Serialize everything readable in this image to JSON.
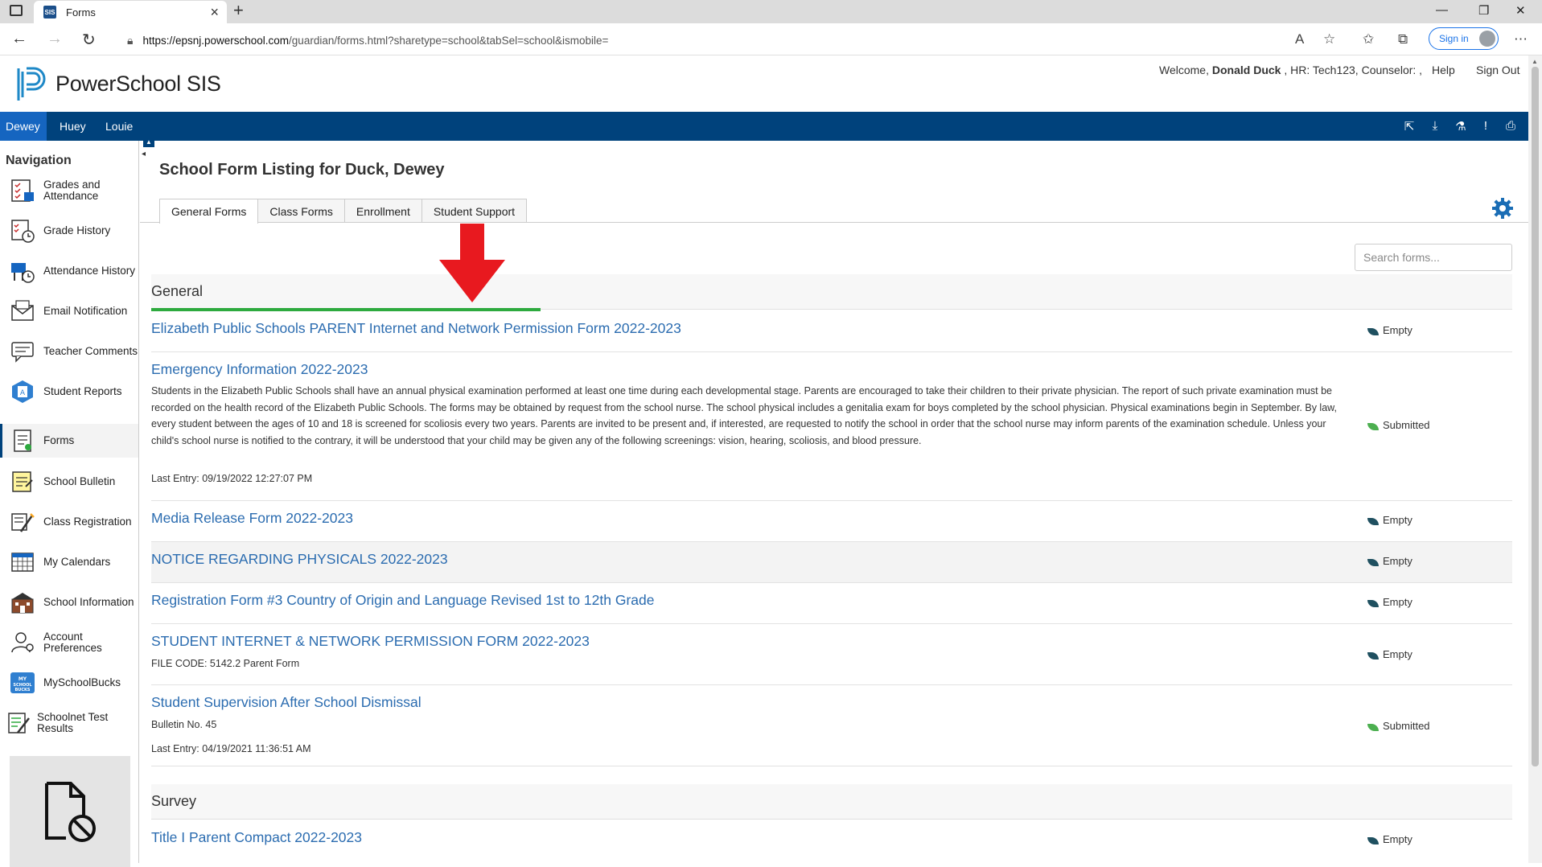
{
  "browser": {
    "tab_title": "Forms",
    "favicon_text": "SIS",
    "url_domain": "https://epsnj.powerschool.com",
    "url_path": "/guardian/forms.html?sharetype=school&tabSel=school&ismobile=",
    "signin_label": "Sign in"
  },
  "header": {
    "app_name": "PowerSchool SIS",
    "welcome_prefix": "Welcome, ",
    "user_name": "Donald Duck",
    "welcome_suffix": " , HR: Tech123, Counselor:  ,",
    "help_label": "Help",
    "signout_label": "Sign Out"
  },
  "students": [
    "Dewey",
    "Huey",
    "Louie"
  ],
  "navigation": {
    "heading": "Navigation",
    "items": [
      {
        "label": "Grades and Attendance",
        "icon": "grades-icon"
      },
      {
        "label": "Grade History",
        "icon": "grade-history-icon"
      },
      {
        "label": "Attendance History",
        "icon": "attendance-icon"
      },
      {
        "label": "Email Notification",
        "icon": "email-icon"
      },
      {
        "label": "Teacher Comments",
        "icon": "comments-icon"
      },
      {
        "label": "Student Reports",
        "icon": "reports-icon"
      },
      {
        "label": "Forms",
        "icon": "forms-icon"
      },
      {
        "label": "School Bulletin",
        "icon": "bulletin-icon"
      },
      {
        "label": "Class Registration",
        "icon": "registration-icon"
      },
      {
        "label": "My Calendars",
        "icon": "calendar-icon"
      },
      {
        "label": "School Information",
        "icon": "school-icon"
      },
      {
        "label": "Account Preferences",
        "icon": "preferences-icon"
      },
      {
        "label": "MySchoolBucks",
        "icon": "myschoolbucks-icon"
      },
      {
        "label": "Schoolnet Test Results",
        "icon": "test-results-icon"
      }
    ]
  },
  "main": {
    "title": "School Form Listing for Duck, Dewey",
    "tabs": [
      "General Forms",
      "Class Forms",
      "Enrollment",
      "Student Support"
    ],
    "search_placeholder": "Search forms...",
    "sections": [
      {
        "title": "General"
      },
      {
        "title": "Survey"
      }
    ],
    "forms": [
      {
        "title": "Elizabeth Public Schools PARENT Internet and Network Permission Form 2022-2023",
        "status": "Empty"
      },
      {
        "title": "Emergency Information 2022-2023",
        "description": "Students in the Elizabeth Public Schools shall have an annual physical examination performed at least one time during each developmental stage. Parents are encouraged to take their children to their private physician. The report of such private examination must be recorded on the health record of the Elizabeth Public Schools. The forms may be obtained by request from the school nurse. The school physical includes a genitalia exam for boys completed by the school physician. Physical examinations begin in September. By law, every student between the ages of 10 and 18 is screened for scoliosis every two years. Parents are invited to be present and, if interested, are requested to notify the school in order that the school nurse may inform parents of the examination schedule. Unless your child's school nurse is notified to the contrary, it will be understood that your child may be given any of the following screenings: vision, hearing, scoliosis, and blood pressure.",
        "last_entry": "Last Entry: 09/19/2022 12:27:07 PM",
        "status": "Submitted"
      },
      {
        "title": "Media Release Form 2022-2023",
        "status": "Empty"
      },
      {
        "title": "NOTICE REGARDING PHYSICALS 2022-2023",
        "status": "Empty"
      },
      {
        "title": "Registration Form #3 Country of Origin and Language Revised 1st to 12th Grade",
        "status": "Empty"
      },
      {
        "title": "STUDENT INTERNET & NETWORK PERMISSION FORM 2022-2023",
        "subtitle": "FILE CODE: 5142.2 Parent Form",
        "status": "Empty"
      },
      {
        "title": "Student Supervision After School Dismissal",
        "subtitle": "Bulletin No. 45",
        "last_entry": "Last Entry: 04/19/2021 11:36:51 AM",
        "status": "Submitted"
      },
      {
        "title": "Title I Parent Compact 2022-2023",
        "status": "Empty"
      }
    ]
  },
  "colors": {
    "brand_blue": "#00427c",
    "active_student": "#1565c0",
    "link_blue": "#2b6cb0",
    "progress_green": "#2eaa3f",
    "arrow_red": "#e8191f"
  }
}
